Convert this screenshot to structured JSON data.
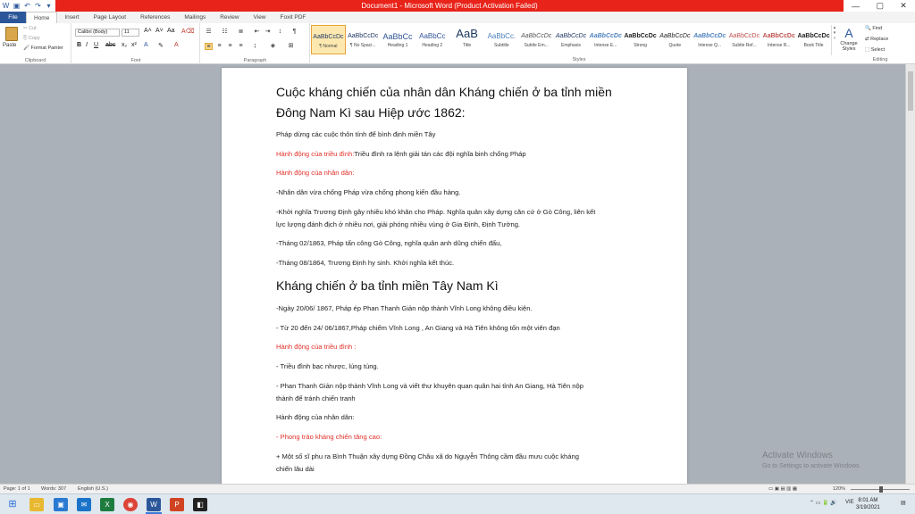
{
  "titlebar": {
    "title": "Document1 - Microsoft Word (Product Activation Failed)",
    "controls": [
      "—",
      "▢",
      "✕"
    ]
  },
  "tabs": [
    "File",
    "Home",
    "Insert",
    "Page Layout",
    "References",
    "Mailings",
    "Review",
    "View",
    "Foxit PDF"
  ],
  "clipboard": {
    "paste": "Paste",
    "cut": "Cut",
    "copy": "Copy",
    "format_painter": "Format Painter",
    "label": "Clipboard"
  },
  "font": {
    "family": "Calibri (Body)",
    "size": "11",
    "label": "Font"
  },
  "paragraph": {
    "label": "Paragraph"
  },
  "styles": {
    "label": "Styles",
    "items": [
      {
        "preview": "AaBbCcDc",
        "name": "¶ Normal"
      },
      {
        "preview": "AaBbCcDc",
        "name": "¶ No Spaci..."
      },
      {
        "preview": "AaBbCc",
        "name": "Heading 1"
      },
      {
        "preview": "AaBbCc",
        "name": "Heading 2"
      },
      {
        "preview": "AaB",
        "name": "Title"
      },
      {
        "preview": "AaBbCc.",
        "name": "Subtitle"
      },
      {
        "preview": "AaBbCcDc",
        "name": "Subtle Em..."
      },
      {
        "preview": "AaBbCcDc",
        "name": "Emphasis"
      },
      {
        "preview": "AaBbCcDc",
        "name": "Intense E..."
      },
      {
        "preview": "AaBbCcDc",
        "name": "Strong"
      },
      {
        "preview": "AaBbCcDc",
        "name": "Quote"
      },
      {
        "preview": "AaBbCcDc",
        "name": "Intense Q..."
      },
      {
        "preview": "AaBbCcDc",
        "name": "Subtle Ref..."
      },
      {
        "preview": "AaBbCcDc",
        "name": "Intense R..."
      },
      {
        "preview": "AaBbCcDc",
        "name": "Book Title"
      }
    ],
    "change_styles": "Change Styles"
  },
  "editing": {
    "label": "Editing",
    "find": "Find",
    "replace": "Replace",
    "select": "Select"
  },
  "document": {
    "heading1_line1": "Cuộc kháng chiến của nhân dân Kháng chiến ở ba tỉnh miền",
    "heading1_line2": "Đông Nam Kì sau Hiệp ước 1862:",
    "p1": "Pháp dừng các cuộc thôn tính để bình định miền Tây",
    "p2_red": "Hành động của triều đình:",
    "p2_rest": "Triều đình ra lệnh giải tán các đội nghĩa binh chống Pháp",
    "p3": " Hành động của nhân dân:",
    "p4": "-Nhân dân vừa chống Pháp vừa chống phong kiến đầu hàng.",
    "p5_line1": "  -Khởi nghĩa Trương Định gây nhiều khó khăn cho Pháp. Nghĩa quân xây dựng căn cứ ở Gò Công, liên kết",
    "p5_line2": "lực lượng đánh địch ở nhiều nơi, giải phóng nhiều vùng ở Gia Định, Định Tường.",
    "p6": " -Tháng 02/1863, Pháp tấn công Gò Công, nghĩa quân anh dũng chiến đấu,",
    "p7": "-Tháng 08/1864, Trương Định hy sinh. Khởi nghĩa kết thúc.",
    "heading2": " Kháng chiến ở ba tỉnh miền Tây Nam Kì",
    "p8": "-Ngày 20/06/ 1867, Pháp ép Phan Thanh Giản nộp thành Vĩnh Long không điều kiện.",
    "p9": " - Từ 20 đến 24/ 06/1867,Pháp chiếm Vĩnh Long , An Giang và Hà Tiên không tốn một viên đạn",
    "p10": "Hành động của triều đình :",
    "p11": "- Triều đình bạc nhược, lúng túng.",
    "p12_line1": " - Phan Thanh Giản nộp thành Vĩnh Long và viết thư khuyên quan quân hai tỉnh An Giang, Hà Tiên nộp",
    "p12_line2": "thành để tránh chiến tranh",
    "p13": "Hành động của nhân dân:",
    "p14": " - Phong trào kháng chiến tăng cao:",
    "p15_line1": " + Một số sĩ phu ra Bình Thuận xây dựng Đồng Châu xã do Nguyễn Thông cầm đầu mưu cuộc kháng",
    "p15_line2": "chiến lâu dài"
  },
  "watermark": {
    "line1": "Activate Windows",
    "line2": "Go to Settings to activate Windows."
  },
  "statusbar": {
    "page": "Page: 1 of 1",
    "words": "Words: 307",
    "language": "English (U.S.)",
    "zoom": "120%"
  },
  "taskbar": {
    "time": "8:01 AM",
    "date": "3/19/2021",
    "lang": "VIE"
  },
  "colors": {
    "accent": "#2b579a",
    "titlebar_red": "#e8231a",
    "doc_red": "#e2312a"
  }
}
